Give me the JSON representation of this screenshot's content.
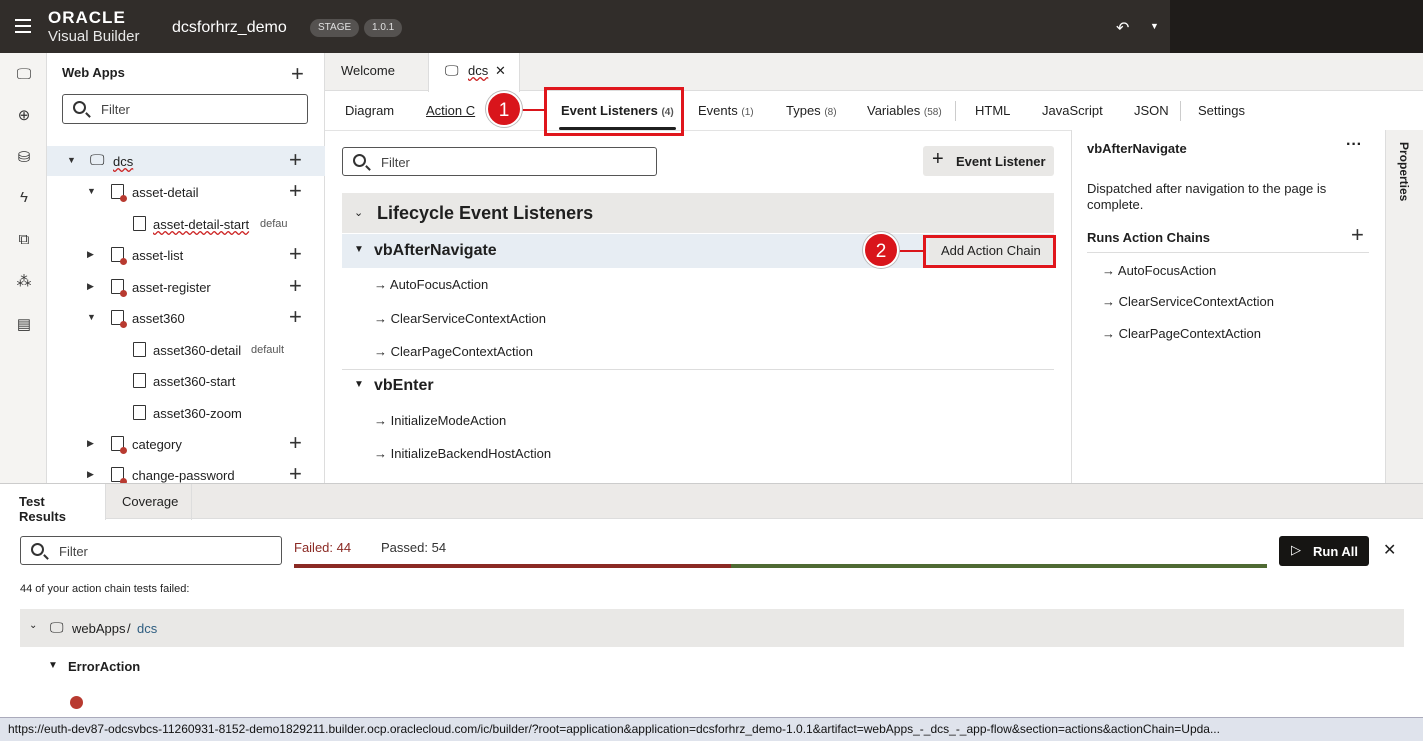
{
  "header": {
    "brand": "ORACLE",
    "product": "Visual Builder",
    "app_name": "dcsforhrz_demo",
    "stage_badge": "STAGE",
    "version_badge": "1.0.1"
  },
  "navigator": {
    "title": "Web Apps",
    "filter_placeholder": "Filter",
    "items": [
      {
        "label": "dcs"
      },
      {
        "label": "asset-detail"
      },
      {
        "label": "asset-detail-start",
        "sub": "defau"
      },
      {
        "label": "asset-list"
      },
      {
        "label": "asset-register"
      },
      {
        "label": "asset360"
      },
      {
        "label": "asset360-detail",
        "sub": "default"
      },
      {
        "label": "asset360-start"
      },
      {
        "label": "asset360-zoom"
      },
      {
        "label": "category"
      },
      {
        "label": "change-password"
      }
    ]
  },
  "file_tabs": [
    {
      "label": "Welcome"
    },
    {
      "label": "dcs"
    }
  ],
  "sub_tabs": [
    {
      "label": "Diagram",
      "count": ""
    },
    {
      "label": "Action C",
      "count": ""
    },
    {
      "label": "Event Listeners",
      "count": "(4)"
    },
    {
      "label": "Events",
      "count": "(1)"
    },
    {
      "label": "Types",
      "count": "(8)"
    },
    {
      "label": "Variables",
      "count": "(58)"
    },
    {
      "label": "HTML",
      "count": ""
    },
    {
      "label": "JavaScript",
      "count": ""
    },
    {
      "label": "JSON",
      "count": ""
    },
    {
      "label": "Settings",
      "count": ""
    }
  ],
  "callouts": {
    "one": "1",
    "two": "2"
  },
  "listeners": {
    "filter_placeholder": "Filter",
    "add_button": "Event Listener",
    "section_title": "Lifecycle Event Listeners",
    "events": [
      {
        "name": "vbAfterNavigate",
        "actions": [
          "AutoFocusAction",
          "ClearServiceContextAction",
          "ClearPageContextAction"
        ]
      },
      {
        "name": "vbEnter",
        "actions": [
          "InitializeModeAction",
          "InitializeBackendHostAction"
        ]
      }
    ],
    "add_action_chain": "Add Action Chain",
    "arrow": "→"
  },
  "properties": {
    "title": "vbAfterNavigate",
    "more": "···",
    "description": "Dispatched after navigation to the page is complete.",
    "runs_label": "Runs Action Chains",
    "chains": [
      "AutoFocusAction",
      "ClearServiceContextAction",
      "ClearPageContextAction"
    ],
    "side_tab": "Properties"
  },
  "tests": {
    "tabs": [
      {
        "label": "Test Results"
      },
      {
        "label": "Coverage"
      }
    ],
    "filter_placeholder": "Filter",
    "failed_label": "Failed: 44",
    "passed_label": "Passed: 54",
    "failed": 44,
    "passed": 54,
    "run_all": "Run All",
    "summary": "44 of your action chain tests failed:",
    "group_root": "webApps",
    "group_sep": "/",
    "group_page": "dcs",
    "subgroup": "ErrorAction",
    "colors": {
      "failed": "#8b2a24",
      "passed": "#4f6a33"
    }
  },
  "status_url": "https://euth-dev87-odcsvbcs-11260931-8152-demo1829211.builder.ocp.oraclecloud.com/ic/builder/?root=application&application=dcsforhrz_demo-1.0.1&artifact=webApps_-_dcs_-_app-flow&section=actions&actionChain=Upda..."
}
